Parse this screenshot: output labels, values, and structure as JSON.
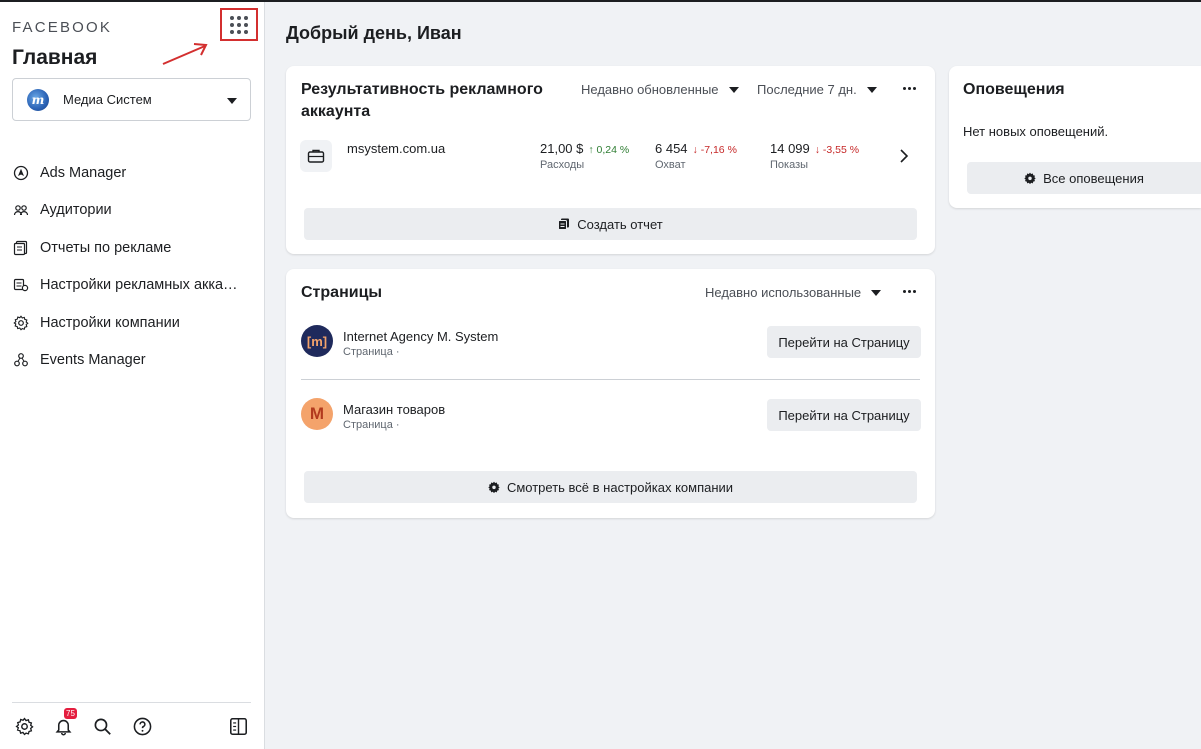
{
  "sidebar": {
    "brand": "FACEBOOK",
    "heading": "Главная",
    "account": {
      "name": "Медиа Систем",
      "logo_letter": "m"
    },
    "items": [
      {
        "label": "Ads Manager",
        "icon": "ads-manager-icon"
      },
      {
        "label": "Аудитории",
        "icon": "audiences-icon"
      },
      {
        "label": "Отчеты по рекламе",
        "icon": "reports-icon"
      },
      {
        "label": "Настройки рекламных аккау...",
        "icon": "ad-account-settings-icon"
      },
      {
        "label": "Настройки компании",
        "icon": "gear-icon"
      },
      {
        "label": "Events Manager",
        "icon": "events-manager-icon"
      }
    ],
    "footer": {
      "notifications_count": "75"
    }
  },
  "main": {
    "greeting": "Добрый день, Иван",
    "performance": {
      "title": "Результативность рекламного аккаунта",
      "sort_label": "Недавно обновленные",
      "period_label": "Последние 7 дн.",
      "account": "msystem.com.ua",
      "metrics": [
        {
          "value": "21,00 $",
          "change": "↑ 0,24 %",
          "direction": "up",
          "label": "Расходы"
        },
        {
          "value": "6 454",
          "change": "↓ -7,16 %",
          "direction": "down",
          "label": "Охват"
        },
        {
          "value": "14 099",
          "change": "↓ -3,55 %",
          "direction": "down",
          "label": "Показы"
        }
      ],
      "create_report_label": "Создать отчет"
    },
    "pages": {
      "title": "Страницы",
      "sort_label": "Недавно использованные",
      "items": [
        {
          "name": "Internet Agency M. System",
          "subtitle": "Страница ·",
          "avatar_text": "[m]",
          "action": "Перейти на Страницу"
        },
        {
          "name": "Магазин товаров",
          "subtitle": "Страница ·",
          "avatar_text": "M",
          "action": "Перейти на Страницу"
        }
      ],
      "view_all_label": "Смотреть всё в настройках компании"
    },
    "notifications": {
      "title": "Оповещения",
      "empty_text": "Нет новых оповещений.",
      "all_label": "Все оповещения"
    }
  },
  "colors": {
    "annotation_red": "#d32f2f",
    "positive": "#2e7d32",
    "negative": "#c62828",
    "background": "#f0f2f5",
    "page_avatar_1": "#1f2a5c",
    "page_avatar_2": "#f4a36b"
  }
}
